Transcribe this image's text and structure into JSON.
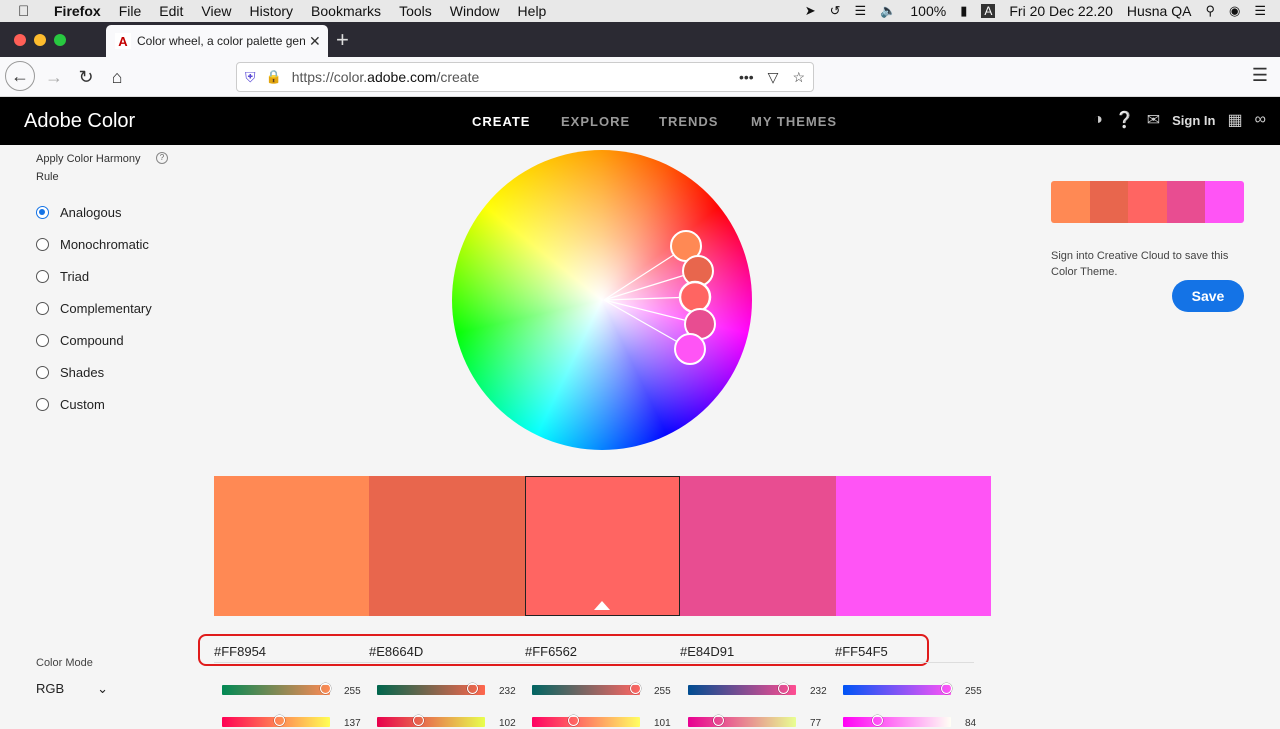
{
  "menubar": {
    "app": "Firefox",
    "items": [
      "File",
      "Edit",
      "View",
      "History",
      "Bookmarks",
      "Tools",
      "Window",
      "Help"
    ],
    "battery": "100%",
    "input_source": "A",
    "datetime": "Fri 20 Dec  22.20",
    "user": "Husna QA"
  },
  "browser": {
    "tab_title": "Color wheel, a color palette generator | Adobe Color",
    "url_prefix": "https://color.",
    "url_host": "adobe.com",
    "url_path": "/create"
  },
  "header": {
    "brand": "Adobe Color",
    "nav": [
      "CREATE",
      "EXPLORE",
      "TRENDS",
      "MY THEMES"
    ],
    "active_nav": "CREATE",
    "sign_in": "Sign In"
  },
  "harmony": {
    "title": "Apply Color Harmony Rule",
    "rules": [
      "Analogous",
      "Monochromatic",
      "Triad",
      "Complementary",
      "Compound",
      "Shades",
      "Custom"
    ],
    "selected": "Analogous"
  },
  "theme": {
    "colors": [
      "#FF8954",
      "#E8664D",
      "#FF6562",
      "#E84D91",
      "#FF54F5"
    ],
    "selected_index": 2,
    "save_message": "Sign into Creative Cloud to save this Color Theme.",
    "save_label": "Save"
  },
  "color_mode": {
    "label": "Color Mode",
    "value": "RGB"
  },
  "channels": {
    "r": [
      255,
      232,
      255,
      232,
      255
    ],
    "g": [
      137,
      102,
      101,
      77,
      84
    ]
  }
}
